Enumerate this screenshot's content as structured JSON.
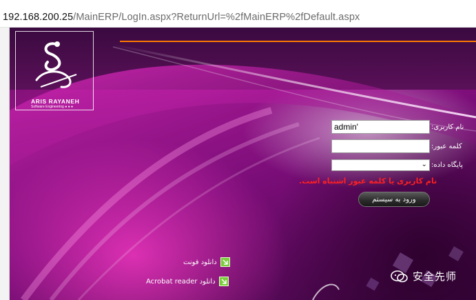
{
  "address_bar": {
    "host": "192.168.200.25",
    "path": "/MainERP/LogIn.aspx?ReturnUrl=%2fMainERP%2fDefault.aspx"
  },
  "logo": {
    "company": "ARIS RAYANEH",
    "tagline": "Software Engineering"
  },
  "login_form": {
    "username_label": "نام کاربری:",
    "username_value": "admin'",
    "password_label": "کلمه عبور:",
    "password_value": "",
    "database_label": "پایگاه داده:",
    "database_selected": "",
    "error_message": "نام کاربری یا کلمه عبور اشتباه است.",
    "login_button_label": "ورود به سیستم"
  },
  "downloads": [
    {
      "label": "دانلود فونت",
      "icon": "download-arrow-icon"
    },
    {
      "label": "دانلود Acrobat reader",
      "icon": "download-arrow-icon"
    }
  ],
  "watermark": {
    "text": "安全先师",
    "icon": "wechat-logo-icon"
  },
  "colors": {
    "accent_orange": "#ff7a00",
    "error_red": "#ff2020",
    "background_magenta": "#a01890"
  }
}
